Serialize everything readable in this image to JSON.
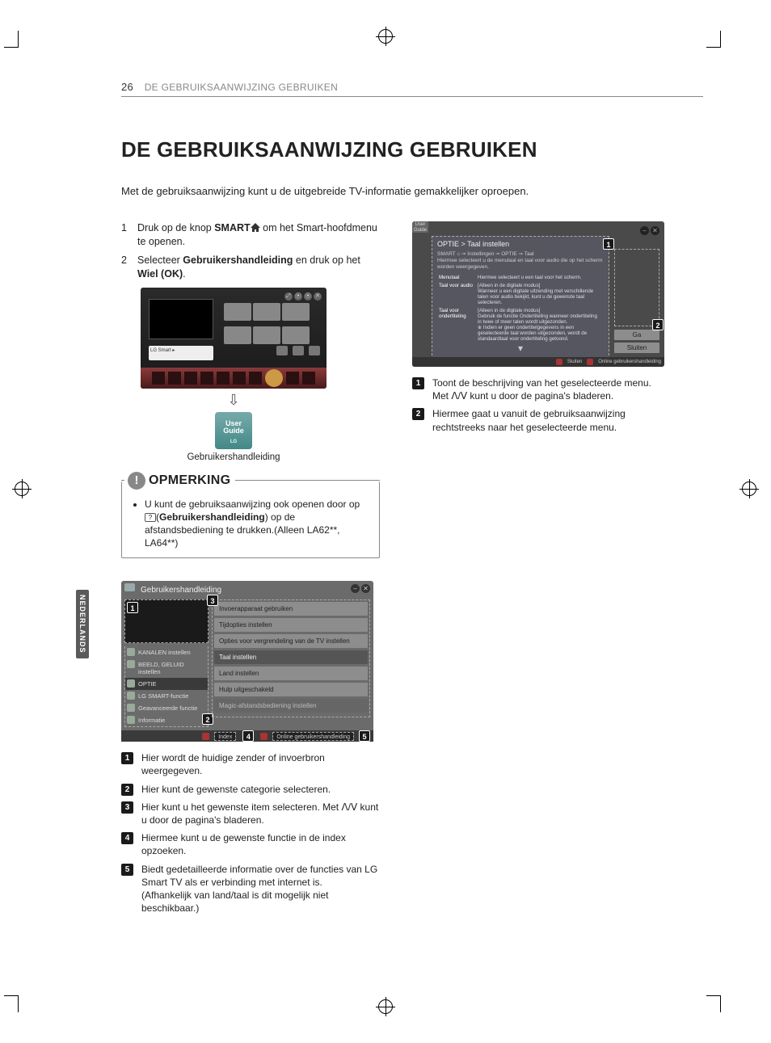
{
  "header": {
    "page_number": "26",
    "section": "DE GEBRUIKSAANWIJZING GEBRUIKEN"
  },
  "side_tab": "NEDERLANDS",
  "title": "DE GEBRUIKSAANWIJZING GEBRUIKEN",
  "intro": "Met de gebruiksaanwijzing kunt u de uitgebreide TV-informatie gemakkelijker oproepen.",
  "steps": [
    {
      "n": "1",
      "pre": "Druk op de knop ",
      "b1": "SMART",
      "post": " om het Smart-hoofdmenu te openen."
    },
    {
      "n": "2",
      "pre": "Selecteer ",
      "b1": "Gebruikershandleiding",
      "mid": " en druk op het ",
      "b2": "Wiel (OK)",
      "post": "."
    }
  ],
  "guide_card": {
    "line1": "User",
    "line2": "Guide",
    "brand": "LG"
  },
  "guide_caption": "Gebruikershandleiding",
  "note": {
    "title": "OPMERKING",
    "text_pre": "U kunt de gebruiksaanwijzing ook openen door op ",
    "icon_text": "?",
    "text_b": "Gebruikershandleiding",
    "text_post": ") op de afstandsbediening te drukken.(Alleen LA62**, LA64**)"
  },
  "panel": {
    "title": "Gebruikershandleiding",
    "left_categories": [
      "KANALEN instellen",
      "BEELD, GELUID instellen",
      "OPTIE",
      "LG SMART-functie",
      "Geavanceerde functie",
      "Informatie"
    ],
    "right_items": [
      "Invoerapparaat gebruiken",
      "Tijdopties instellen",
      "Opties voor vergrendeling van de TV instellen",
      "Taal instellen",
      "Land instellen",
      "Hulp uitgeschakeld",
      "Magic-afstandsbediening instellen"
    ],
    "foot_index": "Index",
    "foot_online": "Online gebruikershandleiding"
  },
  "panel_legend": [
    "Hier wordt de huidige zender of invoerbron weergegeven.",
    "Hier kunt de gewenste categorie selecteren.",
    "Hier kunt u het gewenste item selecteren. Met ꓥ/ꓦ kunt u door de pagina's bladeren.",
    "Hiermee kunt u de gewenste functie in de index opzoeken.",
    "Biedt gedetailleerde informatie over de functies van LG Smart TV als er verbinding met internet is.\n(Afhankelijk van land/taal is dit mogelijk niet beschikbaar.)"
  ],
  "rpanel": {
    "crumb": "OPTIE > Taal instellen",
    "desc": "SMART ⌂ ➙ Instellingen ➙ OPTIE ➙ Taal\nHiermee selecteert u de menutaal en taal voor audio die op het scherm worden weergegeven.",
    "rows": [
      {
        "l": "Menutaal",
        "r": "Hiermee selecteert u een taal voor het scherm."
      },
      {
        "l": "Taal voor audio",
        "r": "[Alleen in de digitale modus]\nWanneer u een digitale uitzending met verschillende talen voor audio bekijkt, kunt u de gewenste taal selecteren."
      },
      {
        "l": "Taal voor ondertiteling",
        "r": "[Alleen in de digitale modus]\nGebruik de functie Ondertiteling wanneer ondertiteling in twee of meer talen wordt uitgezonden.\n※ Indien er geen ondertitelgegevens in een geselecteerde taal worden uitgezonden, wordt de standaardtaal voor ondertiteling getoond."
      }
    ],
    "btn_go": "Ga",
    "btn_close": "Sluiten",
    "foot_close": "Sluiten",
    "foot_online": "Online gebruikershandleiding"
  },
  "rpanel_legend": [
    "Toont de beschrijving van het geselecteerde menu.\nMet ꓥ/ꓦ kunt u door de pagina's bladeren.",
    "Hiermee gaat u vanuit de gebruiksaanwijzing rechtstreeks naar het geselecteerde menu."
  ]
}
